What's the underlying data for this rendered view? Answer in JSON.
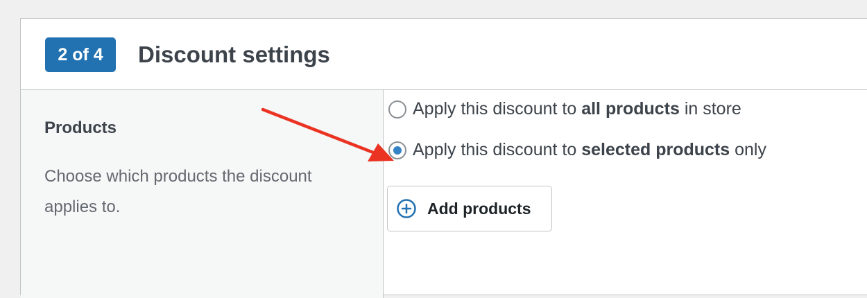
{
  "header": {
    "step_badge": "2 of 4",
    "title": "Discount settings"
  },
  "sidebar": {
    "title": "Products",
    "description": "Choose which products the discount applies to."
  },
  "options": [
    {
      "prefix": "Apply this discount to ",
      "emphasis": "all products",
      "suffix": " in store",
      "selected": false
    },
    {
      "prefix": "Apply this discount to ",
      "emphasis": "selected products",
      "suffix": " only",
      "selected": true
    }
  ],
  "add_button": {
    "label": "Add products",
    "icon": "plus-circle-icon"
  },
  "colors": {
    "badge": "#2271b1",
    "radio_selected": "#3582c4",
    "annotation_arrow": "#ea3323"
  }
}
